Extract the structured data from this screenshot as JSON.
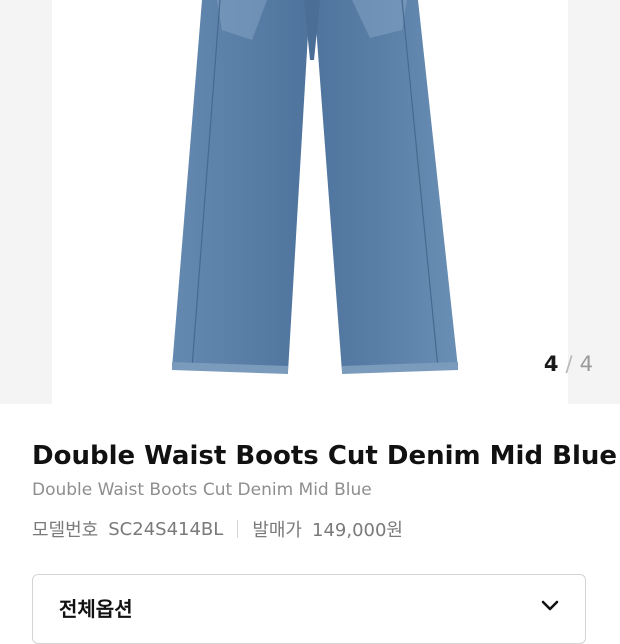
{
  "gallery": {
    "image_icon": "jeans-product-photo",
    "current_index": "4",
    "separator": "/",
    "total": "4"
  },
  "product": {
    "title": "Double Waist Boots Cut Denim Mid Blue",
    "subtitle": "Double Waist Boots Cut Denim Mid Blue",
    "model_label": "모델번호",
    "model_value": "SC24S414BL",
    "price_label": "발매가",
    "price_value": "149,000원"
  },
  "options": {
    "label": "전체옵션",
    "icon": "chevron-down-icon"
  },
  "colors": {
    "denim": "#5b7fa6",
    "image_bg": "#f4f4f4",
    "text_muted": "#8e8e8e"
  }
}
